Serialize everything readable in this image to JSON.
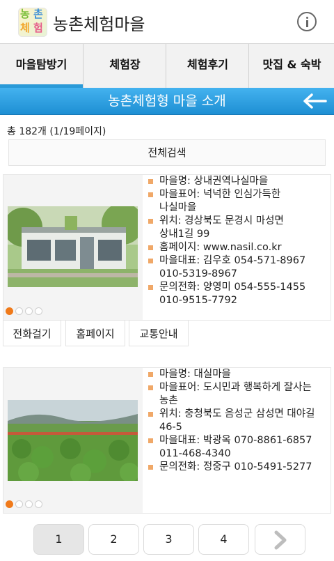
{
  "app": {
    "title": "농촌체험마을",
    "logo_chars": [
      "농",
      "촌",
      "체",
      "험"
    ]
  },
  "tabs": [
    {
      "label": "마을탐방기",
      "active": true
    },
    {
      "label": "체험장",
      "active": false
    },
    {
      "label": "체험후기",
      "active": false
    },
    {
      "label": "맛집 & 숙박",
      "active": false
    }
  ],
  "section": {
    "title": "농촌체험형 마을 소개",
    "count_text": "총 182개 (1/19페이지)",
    "search_all_label": "전체검색"
  },
  "villages": [
    {
      "name_line": "마을명:   상내권역나실마을",
      "motto_line1": "마을표어:  넉넉한 인심가득한",
      "motto_line2": "나실마을",
      "location_line1": "위치:  경상북도 문경시 마성면",
      "location_line2": "상내1길 99",
      "homepage_line": "홈페이지:  www.nasil.co.kr",
      "rep_line1": "마을대표:  김우호 054-571-8967",
      "rep_line2": "010-5319-8967",
      "contact_line1": "문의전화:  양영미 054-555-1455",
      "contact_line2": "010-9515-7792",
      "photo_slide_count": 4,
      "photo_slide_active": 1
    },
    {
      "name_line": "마을명:    대실마을",
      "motto_line1": "마을표어:  도시민과 행복하게 잘사는",
      "motto_line2": "농촌",
      "location_line1": "위치:  충청북도 음성군 삼성면 대야길",
      "location_line2": "46-5",
      "rep_line1": "마을대표:  박광옥  070-8861-6857",
      "rep_line2": "011-468-4340",
      "contact_line1": "문의전화:  정중구  010-5491-5277",
      "photo_slide_count": 4,
      "photo_slide_active": 1
    }
  ],
  "actions": {
    "call_label": "전화걸기",
    "homepage_label": "홈페이지",
    "directions_label": "교통안내"
  },
  "pager": {
    "pages": [
      "1",
      "2",
      "3",
      "4"
    ],
    "current": "1"
  },
  "colors": {
    "accent": "#2a9ad8",
    "band_top": "#44b2ef",
    "band_bottom": "#1e8fd3",
    "bullet": "#f0a868",
    "dot_active": "#f07a1a"
  }
}
